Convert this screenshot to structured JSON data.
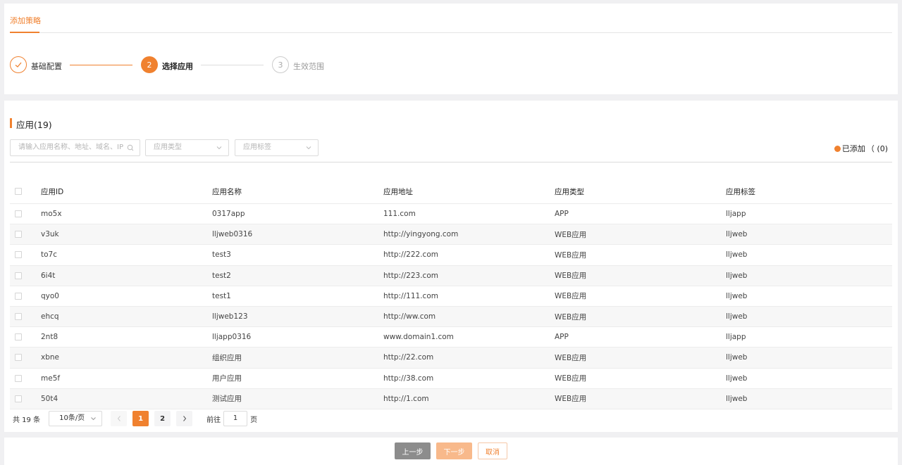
{
  "tabs": {
    "active": "添加策略"
  },
  "steps": [
    {
      "number": "",
      "label": "基础配置",
      "status": "done"
    },
    {
      "number": "2",
      "label": "选择应用",
      "status": "active"
    },
    {
      "number": "3",
      "label": "生效范围",
      "status": "pending"
    }
  ],
  "section": {
    "title": "应用(19)"
  },
  "filters": {
    "search_placeholder": "请输入应用名称、地址、域名、IP",
    "type_placeholder": "应用类型",
    "tag_placeholder": "应用标签"
  },
  "added": {
    "label": "已添加",
    "count": "（  (0)"
  },
  "table": {
    "headers": [
      "应用ID",
      "应用名称",
      "应用地址",
      "应用类型",
      "应用标签"
    ],
    "rows": [
      [
        "mo5x",
        "0317app",
        "111.com",
        "APP",
        "lljapp"
      ],
      [
        "v3uk",
        "lljweb0316",
        "http://yingyong.com",
        "WEB应用",
        "lljweb"
      ],
      [
        "to7c",
        "test3",
        "http://222.com",
        "WEB应用",
        "lljweb"
      ],
      [
        "6i4t",
        "test2",
        "http://223.com",
        "WEB应用",
        "lljweb"
      ],
      [
        "qyo0",
        "test1",
        "http://111.com",
        "WEB应用",
        "lljweb"
      ],
      [
        "ehcq",
        "lljweb123",
        "http://ww.com",
        "WEB应用",
        "lljweb"
      ],
      [
        "2nt8",
        "lljapp0316",
        "www.domain1.com",
        "APP",
        "lljapp"
      ],
      [
        "xbne",
        "组织应用",
        "http://22.com",
        "WEB应用",
        "lljweb"
      ],
      [
        "me5f",
        "用户应用",
        "http://38.com",
        "WEB应用",
        "lljweb"
      ],
      [
        "50t4",
        "测试应用",
        "http://1.com",
        "WEB应用",
        "lljweb"
      ]
    ]
  },
  "pagination": {
    "total": "共 19 条",
    "page_size": "10条/页",
    "pages": [
      "1",
      "2"
    ],
    "current_page": "1",
    "goto_label": "前往",
    "goto_value": "1",
    "goto_suffix": "页"
  },
  "footer": {
    "prev": "上一步",
    "next": "下一步",
    "cancel": "取消"
  },
  "colors": {
    "accent": "#f0812f",
    "prev_button": "#8c8c8c",
    "next_button": "#f8b98b"
  },
  "icons": {
    "search": "search-icon",
    "chevron": "chevron-down-icon",
    "check": "check-icon"
  }
}
